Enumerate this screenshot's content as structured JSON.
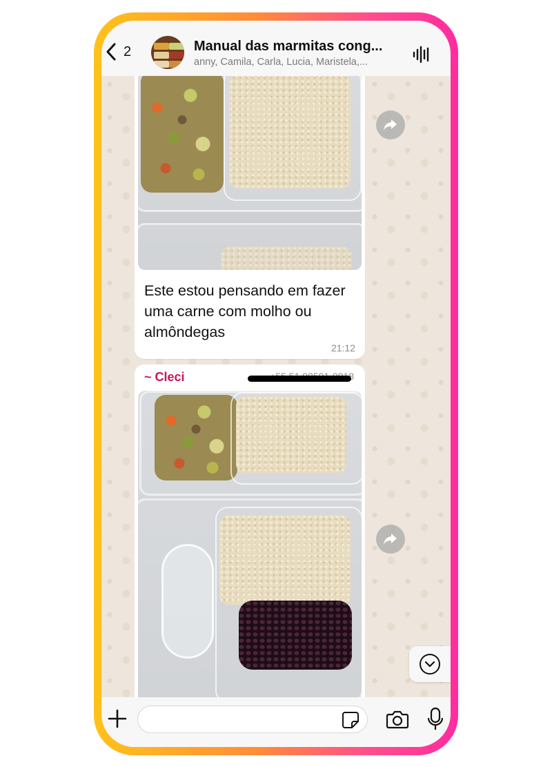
{
  "header": {
    "back_count": "2",
    "title": "Manual das marmitas cong...",
    "subtitle": "anny, Camila, Carla, Lucia, Maristela,..."
  },
  "messages": [
    {
      "text": "Este estou pensando em fazer uma carne com molho ou almôndegas",
      "time": "21:12"
    },
    {
      "sender": "~ Cleci",
      "phone": "+55 51 98591-0818"
    }
  ],
  "composer": {
    "placeholder": ""
  },
  "colors": {
    "sender_name": "#c2185b",
    "frame_gradient_start": "#ffc21a",
    "frame_gradient_end": "#ff2ba0",
    "chat_background": "#eee6dc"
  },
  "icons": {
    "back": "chevron-left-icon",
    "voice": "waveform-icon",
    "forward": "forward-arrow-icon",
    "scroll_down": "chevron-down-circle-icon",
    "plus": "plus-icon",
    "sticker": "sticker-icon",
    "camera": "camera-icon",
    "mic": "microphone-icon"
  }
}
